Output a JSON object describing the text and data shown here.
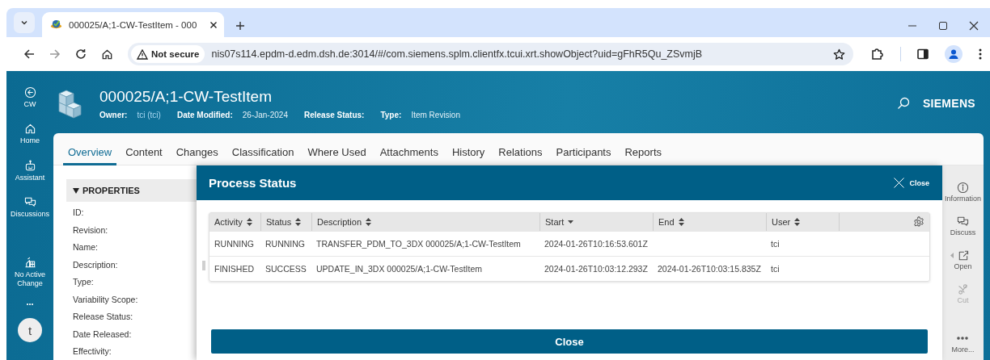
{
  "browser": {
    "tab_title": "000025/A;1-CW-TestItem - 000",
    "security": "Not secure",
    "url": "nis07s114.epdm-d.edm.dsh.de:3014/#/com.siemens.splm.clientfx.tcui.xrt.showObject?uid=gFhR5Qu_ZSvmjB"
  },
  "nav": {
    "items": [
      {
        "kind": "back",
        "label": "CW"
      },
      {
        "kind": "home",
        "label": "Home"
      },
      {
        "kind": "robot",
        "label": "Assistant"
      },
      {
        "kind": "chat",
        "label": "Discussions"
      },
      {
        "kind": "change",
        "label": "No Active Change"
      }
    ],
    "avatar": "t"
  },
  "header": {
    "title": "000025/A;1-CW-TestItem",
    "meta": [
      {
        "label": "Owner:",
        "value": "tci (tci)"
      },
      {
        "label": "Date Modified:",
        "value": "26-Jan-2024"
      },
      {
        "label": "Release Status:"
      },
      {
        "label": "Type:",
        "value": "Item Revision"
      }
    ],
    "brand": "SIEMENS"
  },
  "tabs": [
    {
      "label": "Overview",
      "selected": true
    },
    {
      "label": "Content",
      "selected": false
    },
    {
      "label": "Changes",
      "selected": false
    },
    {
      "label": "Classification",
      "selected": false
    },
    {
      "label": "Where Used",
      "selected": false
    },
    {
      "label": "Attachments",
      "selected": false
    },
    {
      "label": "History",
      "selected": false
    },
    {
      "label": "Relations",
      "selected": false
    },
    {
      "label": "Participants",
      "selected": false
    },
    {
      "label": "Reports",
      "selected": false
    }
  ],
  "properties": {
    "title": "PROPERTIES",
    "expanded": true,
    "fields": [
      "ID:",
      "Revision:",
      "Name:",
      "Description:",
      "Type:",
      "Variability Scope:",
      "Release Status:",
      "Date Released:",
      "Effectivity:"
    ]
  },
  "dialog": {
    "title": "Process Status",
    "close": "Close",
    "columns": [
      {
        "label": "Activity",
        "kind": "sortable"
      },
      {
        "label": "Status",
        "kind": "sortable"
      },
      {
        "label": "Description",
        "kind": "sortable"
      },
      {
        "label": "Start",
        "kind": "sorted"
      },
      {
        "label": "End",
        "kind": "sortable"
      },
      {
        "label": "User",
        "kind": "sortable"
      }
    ],
    "rows": [
      [
        "RUNNING",
        "RUNNING",
        "TRANSFER_PDM_TO_3DX 000025/A;1-CW-TestItem",
        "2024-01-26T10:16:53.601Z",
        "",
        "tci"
      ],
      [
        "FINISHED",
        "SUCCESS",
        "UPDATE_IN_3DX 000025/A;1-CW-TestItem",
        "2024-01-26T10:03:12.293Z",
        "2024-01-26T10:03:15.835Z",
        "tci"
      ]
    ],
    "button": "Close"
  },
  "rail": [
    {
      "kind": "info",
      "label": "Information",
      "disabled": false
    },
    {
      "kind": "chat",
      "label": "Discuss",
      "disabled": false
    },
    {
      "kind": "open",
      "label": "Open",
      "disabled": false
    },
    {
      "kind": "cut",
      "label": "Cut",
      "disabled": true
    },
    {
      "kind": "more",
      "label": "More...",
      "disabled": false
    }
  ]
}
